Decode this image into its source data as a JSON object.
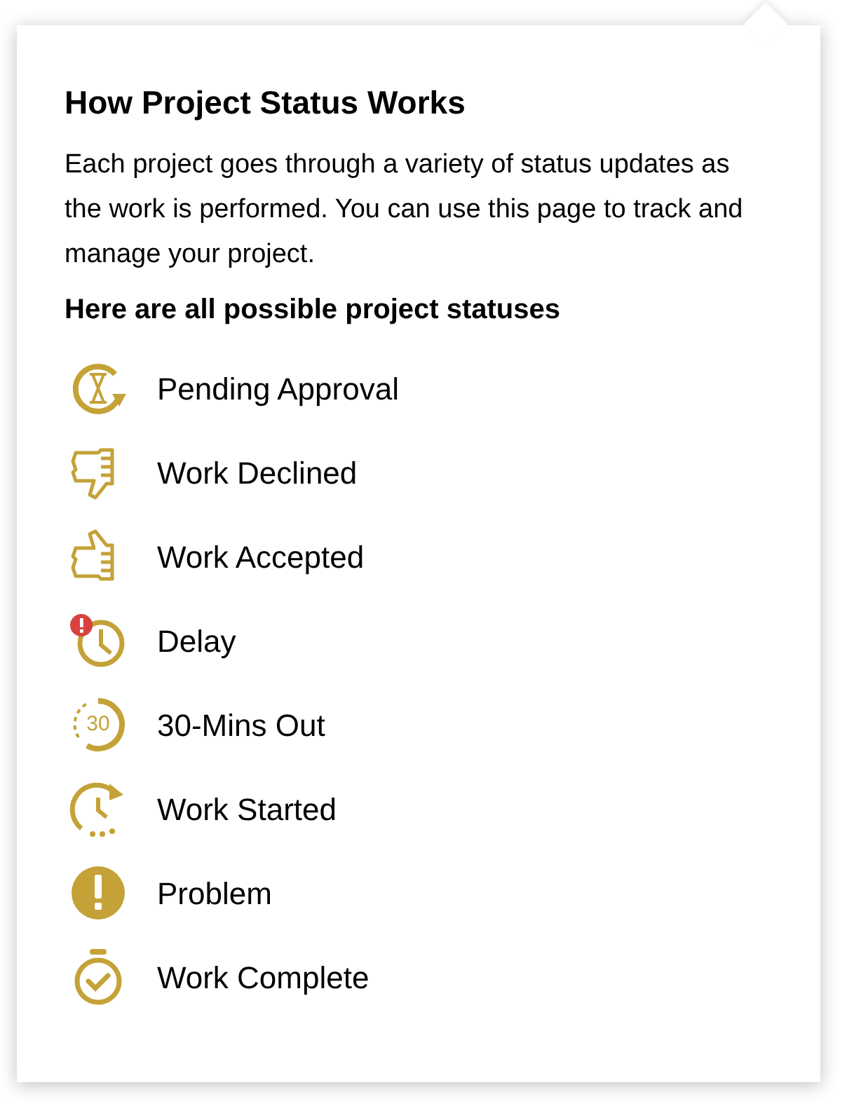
{
  "popover": {
    "title": "How Project Status Works",
    "description": "Each project goes through a variety of status updates as the work is performed. You can use this page to track and manage your project.",
    "list_heading": "Here are all possible project statuses",
    "statuses": [
      {
        "kind": "pending",
        "label": "Pending Approval"
      },
      {
        "kind": "declined",
        "label": "Work Declined"
      },
      {
        "kind": "accepted",
        "label": "Work Accepted"
      },
      {
        "kind": "delay",
        "label": "Delay"
      },
      {
        "kind": "eta",
        "label": "30-Mins Out",
        "icon_text": "30"
      },
      {
        "kind": "started",
        "label": "Work Started"
      },
      {
        "kind": "problem",
        "label": "Problem"
      },
      {
        "kind": "complete",
        "label": "Work Complete"
      }
    ]
  }
}
